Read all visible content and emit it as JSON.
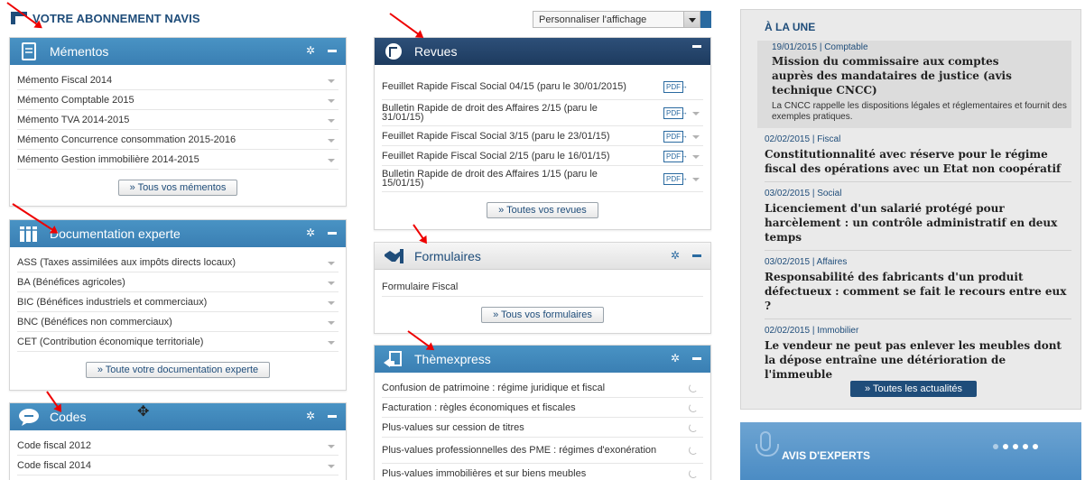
{
  "brand": {
    "title": "VOTRE ABONNEMENT NAVIS"
  },
  "customize": {
    "label": "Personnaliser l'affichage"
  },
  "widgets": {
    "mementos": {
      "title": "Mémentos",
      "items": [
        "Mémento Fiscal 2014",
        "Mémento Comptable 2015",
        "Mémento TVA 2014-2015",
        "Mémento Concurrence consommation 2015-2016",
        "Mémento Gestion immobilière 2014-2015"
      ],
      "button": "» Tous vos mémentos"
    },
    "documentation": {
      "title": "Documentation experte",
      "items": [
        "ASS (Taxes assimilées aux impôts directs locaux)",
        "BA (Bénéfices agricoles)",
        "BIC (Bénéfices industriels et commerciaux)",
        "BNC (Bénéfices non commerciaux)",
        "CET (Contribution économique territoriale)"
      ],
      "button": "» Toute votre documentation experte"
    },
    "codes": {
      "title": "Codes",
      "items": [
        "Code fiscal 2012",
        "Code fiscal 2014"
      ]
    },
    "revues": {
      "title": "Revues",
      "pdf_label": "PDF",
      "items": [
        "Feuillet Rapide Fiscal Social 04/15 (paru le 30/01/2015)",
        "Bulletin Rapide de droit des Affaires 2/15 (paru le 31/01/15)",
        "Feuillet Rapide Fiscal Social 3/15 (paru le 23/01/15)",
        "Feuillet Rapide Fiscal Social 2/15 (paru le 16/01/15)",
        "Bulletin Rapide de droit des Affaires 1/15 (paru le 15/01/15)"
      ],
      "button": "» Toutes vos revues"
    },
    "formulaires": {
      "title": "Formulaires",
      "items": [
        "Formulaire Fiscal"
      ],
      "button": "» Tous vos formulaires"
    },
    "themexpress": {
      "title": "Thèmexpress",
      "items": [
        "Confusion de patrimoine : régime juridique et fiscal",
        "Facturation : règles économiques et fiscales",
        "Plus-values sur cession de titres",
        "Plus-values professionnelles des PME : régimes d'exonération",
        "Plus-values immobilières et sur biens meubles"
      ]
    }
  },
  "news": {
    "title": "À LA UNE",
    "featured": {
      "meta": "19/01/2015 | Comptable",
      "headline": "Mission du commissaire aux comptes auprès des mandataires de justice (avis technique CNCC)",
      "desc": "La CNCC rappelle les dispositions légales et réglementaires et fournit des exemples pratiques."
    },
    "items": [
      {
        "meta": "02/02/2015 | Fiscal",
        "headline": "Constitutionnalité avec réserve pour le régime fiscal des opérations avec un Etat non coopératif"
      },
      {
        "meta": "03/02/2015 | Social",
        "headline": "Licenciement d'un salarié protégé pour harcèlement : un contrôle administratif en deux temps"
      },
      {
        "meta": "03/02/2015 | Affaires",
        "headline": "Responsabilité des fabricants d'un produit défectueux : comment se fait le recours entre eux ?"
      },
      {
        "meta": "02/02/2015 | Immobilier",
        "headline": "Le vendeur ne peut pas enlever les meubles dont la dépose entraîne une détérioration de l'immeuble"
      }
    ],
    "button": "» Toutes les actualités"
  },
  "experts": {
    "title": "AVIS D'EXPERTS"
  },
  "colors": {
    "blue_header": "#3a7fb3",
    "navy_header": "#1d3b5f",
    "accent": "#1f4d7a",
    "annotation_red": "#e00000"
  }
}
